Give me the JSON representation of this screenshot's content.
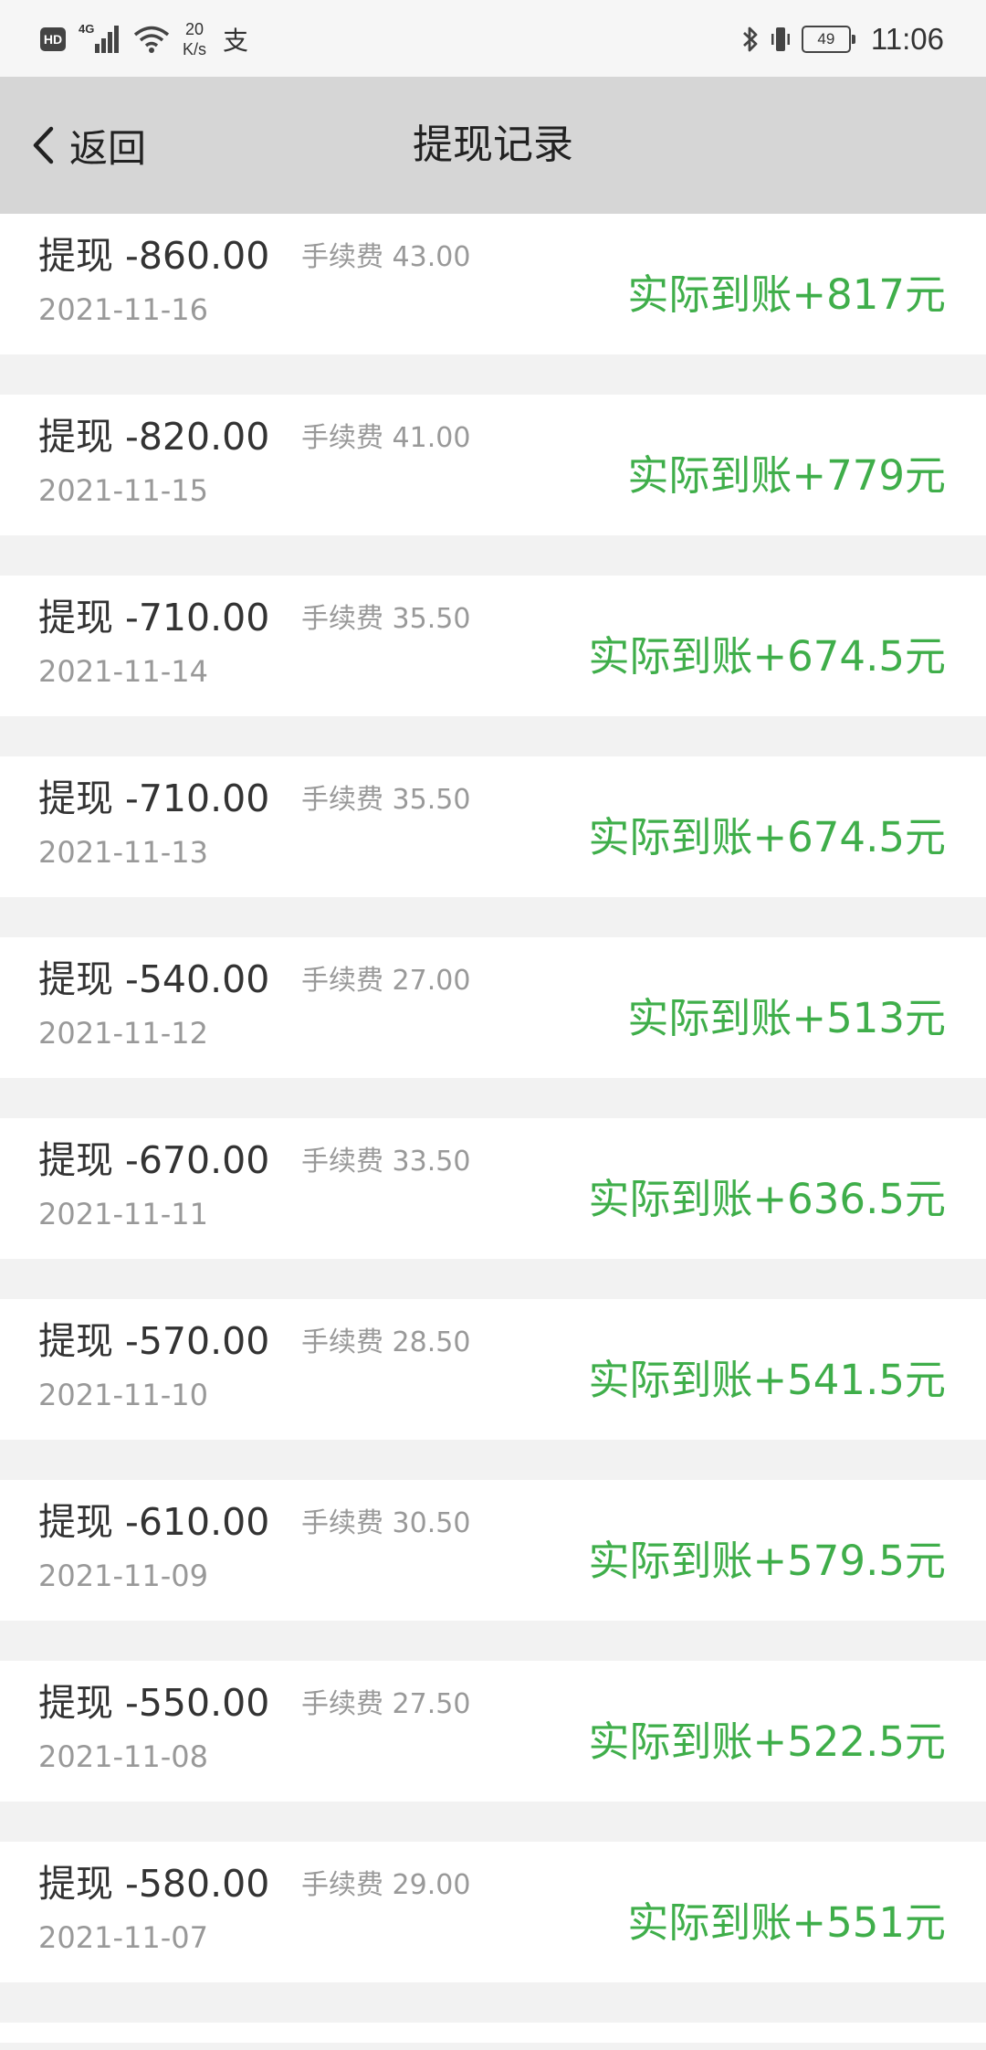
{
  "status_bar": {
    "hd": "HD",
    "network": "4G",
    "speed_value": "20",
    "speed_unit": "K/s",
    "extra_icon": "支",
    "battery": "49",
    "time": "11:06",
    "icons": [
      "signal-icon",
      "wifi-icon",
      "bluetooth-icon",
      "vibrate-icon"
    ]
  },
  "header": {
    "back_label": "返回",
    "title": "提现记录"
  },
  "records": [
    {
      "amount": "提现 -860.00",
      "fee": "手续费 43.00",
      "date": "2021-11-16",
      "received": "实际到账+817元"
    },
    {
      "amount": "提现 -820.00",
      "fee": "手续费 41.00",
      "date": "2021-11-15",
      "received": "实际到账+779元"
    },
    {
      "amount": "提现 -710.00",
      "fee": "手续费 35.50",
      "date": "2021-11-14",
      "received": "实际到账+674.5元"
    },
    {
      "amount": "提现 -710.00",
      "fee": "手续费 35.50",
      "date": "2021-11-13",
      "received": "实际到账+674.5元"
    },
    {
      "amount": "提现 -540.00",
      "fee": "手续费 27.00",
      "date": "2021-11-12",
      "received": "实际到账+513元"
    },
    {
      "amount": "提现 -670.00",
      "fee": "手续费 33.50",
      "date": "2021-11-11",
      "received": "实际到账+636.5元"
    },
    {
      "amount": "提现 -570.00",
      "fee": "手续费 28.50",
      "date": "2021-11-10",
      "received": "实际到账+541.5元"
    },
    {
      "amount": "提现 -610.00",
      "fee": "手续费 30.50",
      "date": "2021-11-09",
      "received": "实际到账+579.5元"
    },
    {
      "amount": "提现 -550.00",
      "fee": "手续费 27.50",
      "date": "2021-11-08",
      "received": "实际到账+522.5元"
    },
    {
      "amount": "提现 -580.00",
      "fee": "手续费 29.00",
      "date": "2021-11-07",
      "received": "实际到账+551元"
    }
  ],
  "colors": {
    "received_green": "#3fae4a",
    "header_bg": "#d6d6d6",
    "separator": "#f2f2f2"
  }
}
